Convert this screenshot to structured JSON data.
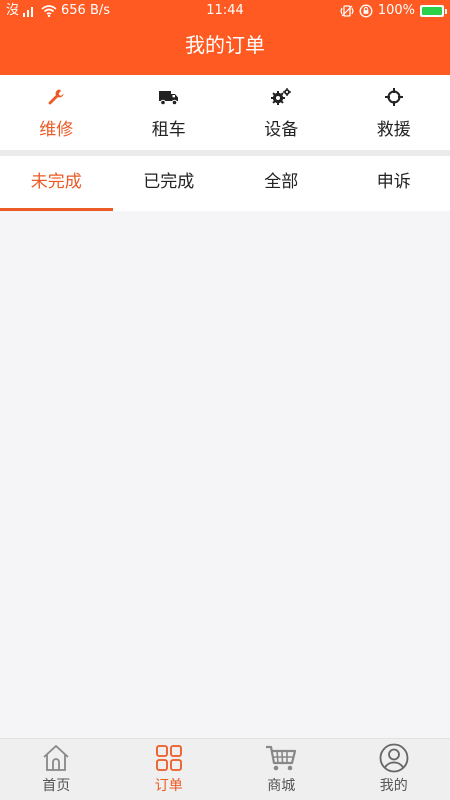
{
  "status_bar": {
    "carrier": "沒",
    "speed": "656 B/s",
    "time": "11:44",
    "battery": "100%",
    "icons": [
      "signal-icon",
      "wifi-icon",
      "vibrate-icon",
      "lock-rotation-icon",
      "battery-icon"
    ]
  },
  "header": {
    "title": "我的订单"
  },
  "categories": [
    {
      "label": "维修",
      "icon": "wrench-icon",
      "active": true
    },
    {
      "label": "租车",
      "icon": "truck-icon",
      "active": false
    },
    {
      "label": "设备",
      "icon": "gears-icon",
      "active": false
    },
    {
      "label": "救援",
      "icon": "crosshair-icon",
      "active": false
    }
  ],
  "tabs": [
    {
      "label": "未完成",
      "active": true
    },
    {
      "label": "已完成",
      "active": false
    },
    {
      "label": "全部",
      "active": false
    },
    {
      "label": "申诉",
      "active": false
    }
  ],
  "bottom_nav": [
    {
      "label": "首页",
      "icon": "home-icon",
      "active": false
    },
    {
      "label": "订单",
      "icon": "grid-icon",
      "active": true
    },
    {
      "label": "商城",
      "icon": "cart-icon",
      "active": false
    },
    {
      "label": "我的",
      "icon": "user-icon",
      "active": false
    }
  ],
  "colors": {
    "header_bg": "#ff5a22",
    "accent": "#ec5a26",
    "page_bg": "#f5f4f6",
    "battery_fill": "#2bd04b"
  }
}
